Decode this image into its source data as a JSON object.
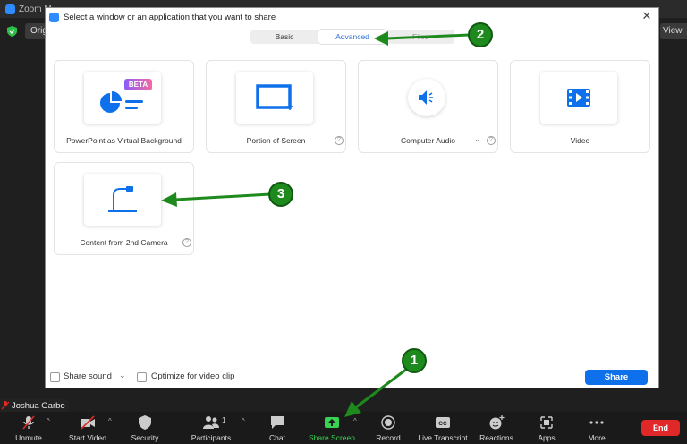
{
  "background": {
    "window_title": "Zoom M",
    "original_chip": "Origi",
    "view_chip": "View"
  },
  "dialog": {
    "title": "Select a window or an application that you want to share",
    "tabs": [
      {
        "label": "Basic"
      },
      {
        "label": "Advanced",
        "active": true
      },
      {
        "label": "Files"
      }
    ],
    "options": [
      {
        "label": "PowerPoint as Virtual Background",
        "badge": "BETA",
        "icon": "slides-chart-icon"
      },
      {
        "label": "Portion of Screen",
        "icon": "screen-portion-icon"
      },
      {
        "label": "Computer Audio",
        "icon": "speaker-icon"
      },
      {
        "label": "Video",
        "icon": "video-file-icon"
      },
      {
        "label": "Content from 2nd Camera",
        "icon": "document-camera-icon"
      }
    ],
    "footer": {
      "share_sound": "Share sound",
      "optimize_video": "Optimize for video clip",
      "share_button": "Share"
    }
  },
  "participant_name": "Joshua Garbo",
  "toolbar": {
    "unmute": "Unmute",
    "start_video": "Start Video",
    "security": "Security",
    "participants": "Participants",
    "participants_count": "1",
    "chat": "Chat",
    "share_screen": "Share Screen",
    "record": "Record",
    "live_transcript": "Live Transcript",
    "reactions": "Reactions",
    "apps": "Apps",
    "more": "More",
    "end": "End"
  },
  "callouts": [
    "1",
    "2",
    "3"
  ],
  "colors": {
    "accent": "#0e71eb",
    "share_green": "#39d353",
    "end_red": "#e02828",
    "callout_green": "#1e8a1e"
  }
}
